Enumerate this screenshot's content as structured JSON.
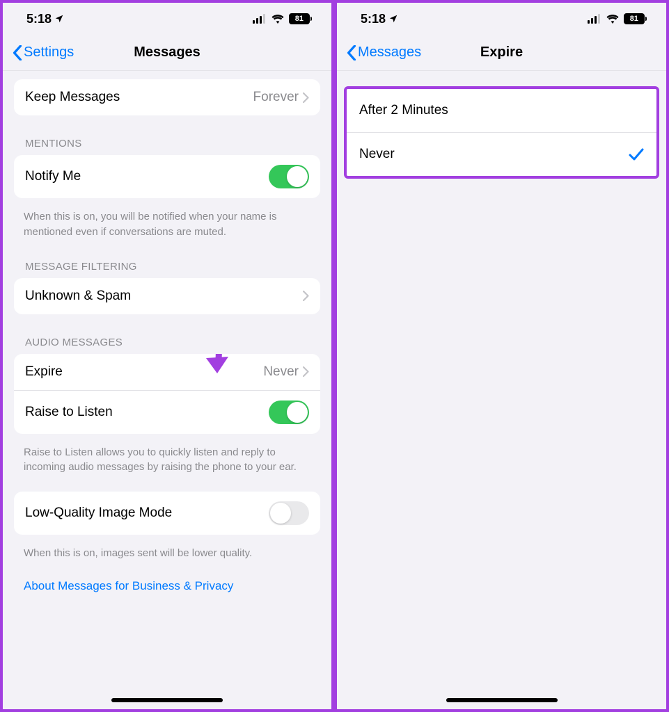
{
  "status": {
    "time": "5:18",
    "battery": "81"
  },
  "left": {
    "nav": {
      "back": "Settings",
      "title": "Messages"
    },
    "keep": {
      "label": "Keep Messages",
      "value": "Forever"
    },
    "mentions": {
      "header": "MENTIONS",
      "notify_label": "Notify Me",
      "notify_on": true,
      "note": "When this is on, you will be notified when your name is mentioned even if conversations are muted."
    },
    "filtering": {
      "header": "MESSAGE FILTERING",
      "row": "Unknown & Spam"
    },
    "audio": {
      "header": "AUDIO MESSAGES",
      "expire_label": "Expire",
      "expire_value": "Never",
      "raise_label": "Raise to Listen",
      "raise_on": true,
      "note": "Raise to Listen allows you to quickly listen and reply to incoming audio messages by raising the phone to your ear."
    },
    "lowq": {
      "label": "Low-Quality Image Mode",
      "on": false,
      "note": "When this is on, images sent will be lower quality."
    },
    "link": "About Messages for Business & Privacy"
  },
  "right": {
    "nav": {
      "back": "Messages",
      "title": "Expire"
    },
    "options": [
      {
        "label": "After 2 Minutes",
        "selected": false
      },
      {
        "label": "Never",
        "selected": true
      }
    ]
  }
}
